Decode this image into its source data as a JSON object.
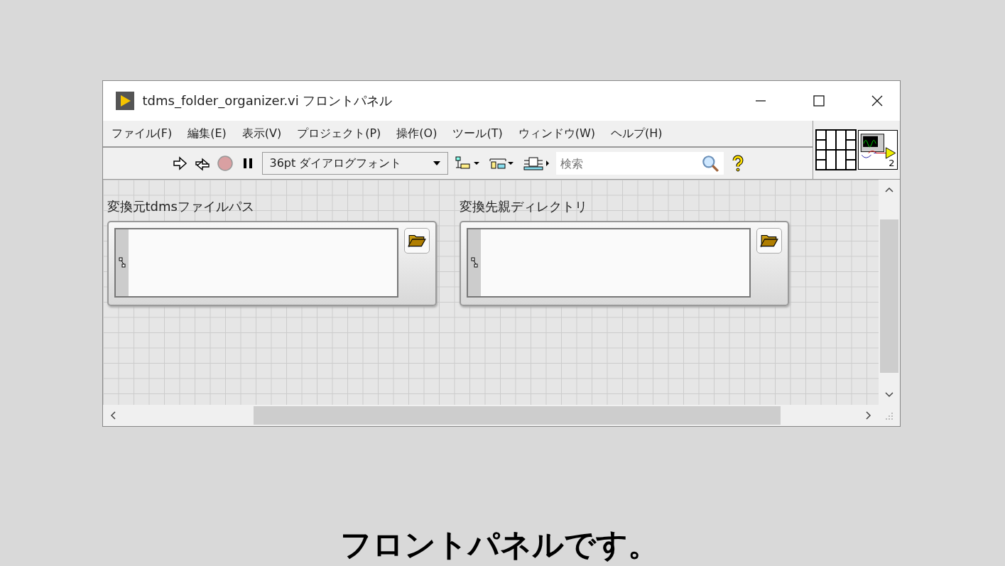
{
  "window": {
    "title": "tdms_folder_organizer.vi フロントパネル"
  },
  "menu": [
    "ファイル(F)",
    "編集(E)",
    "表示(V)",
    "プロジェクト(P)",
    "操作(O)",
    "ツール(T)",
    "ウィンドウ(W)",
    "ヘルプ(H)"
  ],
  "toolbar": {
    "font_selector": "36pt ダイアログフォント",
    "search": {
      "placeholder": "検索"
    }
  },
  "vi_icon": {
    "badge": "2"
  },
  "controls": [
    {
      "label": "変換元tdmsファイルパス"
    },
    {
      "label": "変換先親ディレクトリ"
    }
  ],
  "caption": "フロントパネルです。"
}
